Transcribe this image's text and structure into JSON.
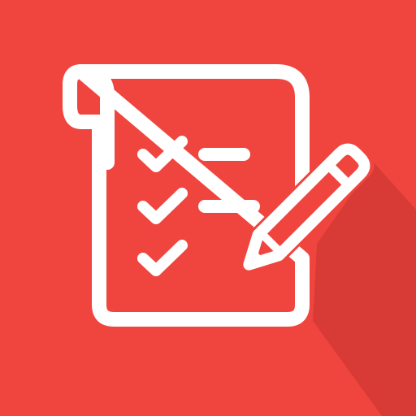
{
  "icon": {
    "name": "checklist-with-pencil-app-icon",
    "background_color": "#F0453F",
    "shadow_color": "#D83A35",
    "glyph_color": "#FFFFFF",
    "checked_items": 3,
    "lines_next_to_checks": 2,
    "glyphs": [
      "scroll-paper-icon",
      "checkmark-icon",
      "pencil-icon"
    ]
  }
}
